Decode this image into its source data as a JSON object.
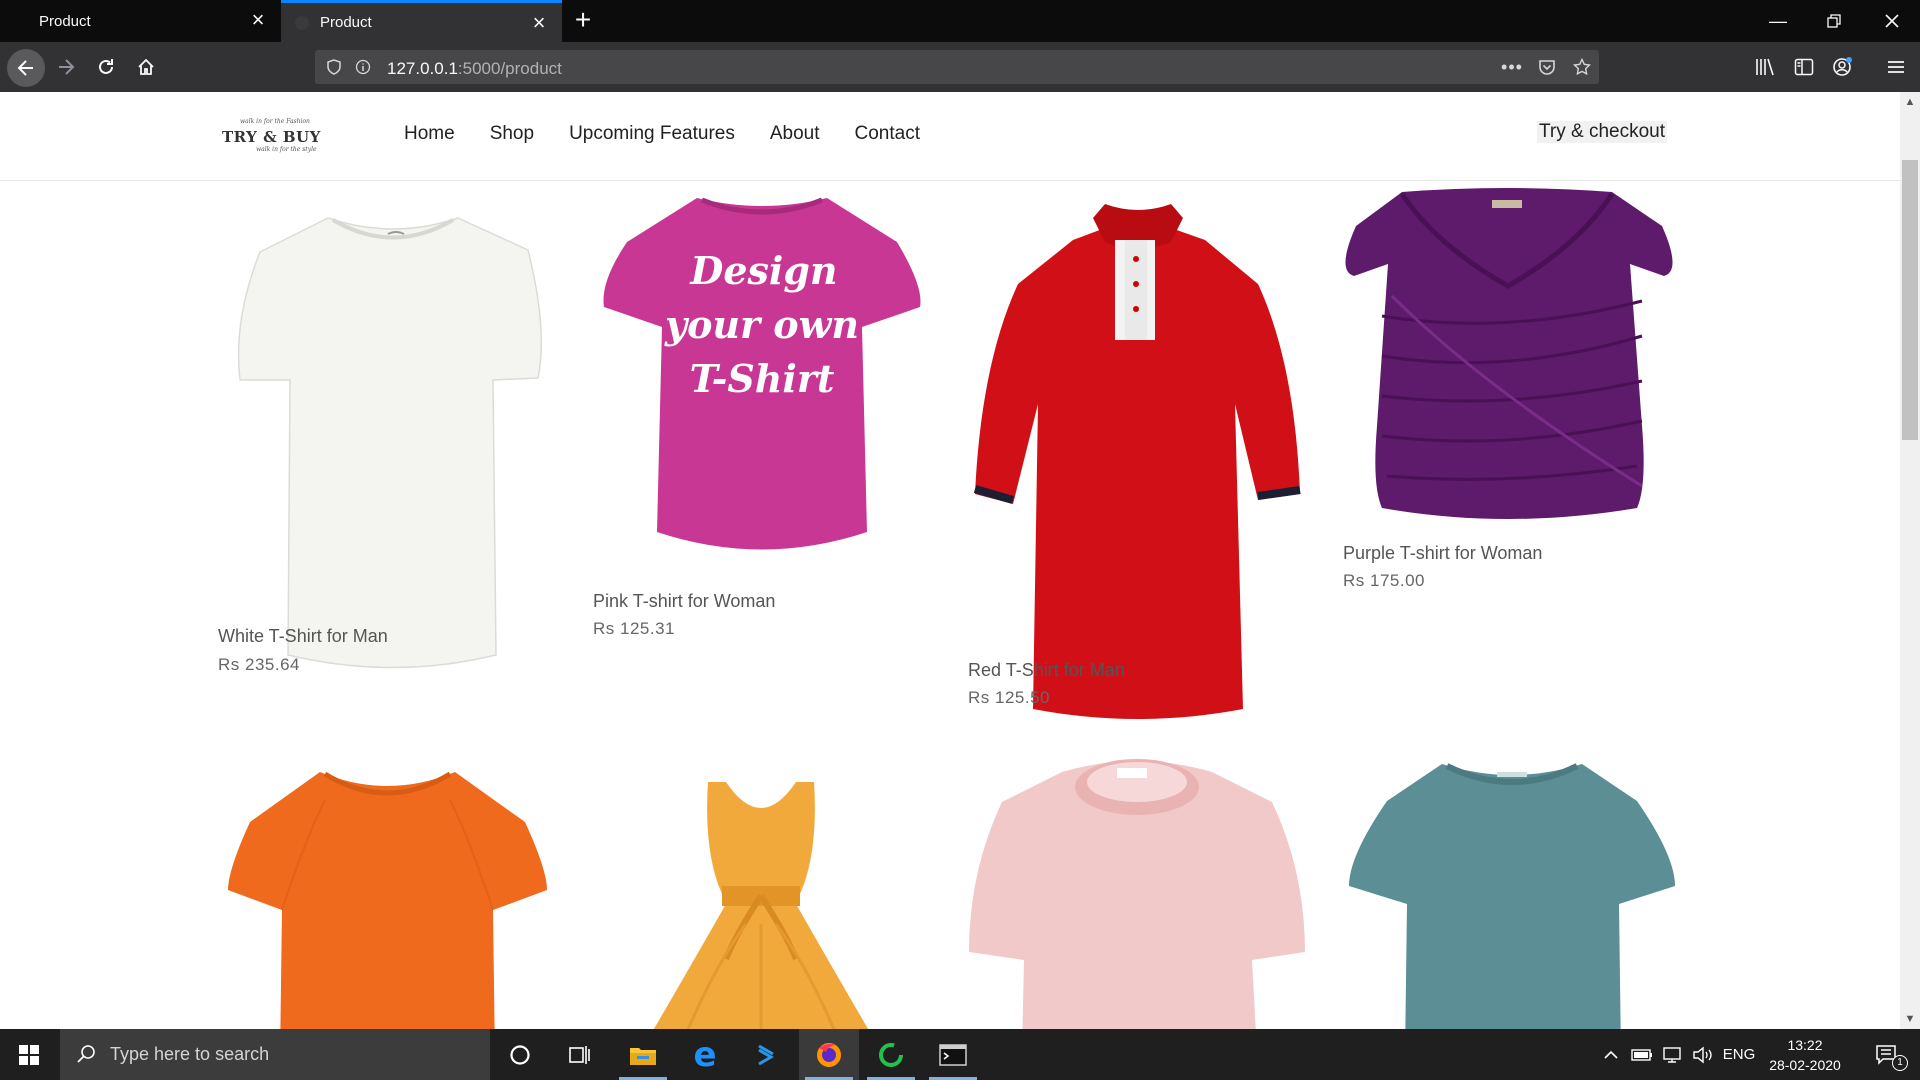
{
  "browser": {
    "tabs": [
      {
        "title": "Product",
        "active": false
      },
      {
        "title": "Product",
        "active": true
      }
    ],
    "url_host": "127.0.0.1",
    "url_path": ":5000/product"
  },
  "site": {
    "logo": {
      "brand": "TRY & BUY",
      "tagline_top": "walk in for the Fashion",
      "tagline_bottom": "walk in for the style"
    },
    "nav": [
      "Home",
      "Shop",
      "Upcoming Features",
      "About",
      "Contact"
    ],
    "cta": "Try & checkout"
  },
  "products": [
    {
      "name": "White T-Shirt for Man",
      "price": "Rs 235.64"
    },
    {
      "name": "Pink T-shirt for Woman",
      "price": "Rs 125.31",
      "print_text": [
        "Design",
        "your own",
        "T-Shirt"
      ]
    },
    {
      "name": "Red T-Shirt for Man",
      "price": "Rs 125.50"
    },
    {
      "name": "Purple T-shirt for Woman",
      "price": "Rs 175.00"
    }
  ],
  "taskbar": {
    "search_placeholder": "Type here to search",
    "language": "ENG",
    "time": "13:22",
    "date": "28-02-2020",
    "notification_count": "1"
  },
  "colors": {
    "accent": "#0a84ff",
    "white_shirt": "#f4f4f0",
    "pink_shirt": "#c93795",
    "red_shirt": "#d10f16",
    "purple_top": "#5e1a6b",
    "orange_shirt": "#ef6a1c",
    "yellow_dress": "#f2a93b",
    "light_pink_shirt": "#f1c9c8",
    "teal_shirt": "#5b8f95"
  }
}
